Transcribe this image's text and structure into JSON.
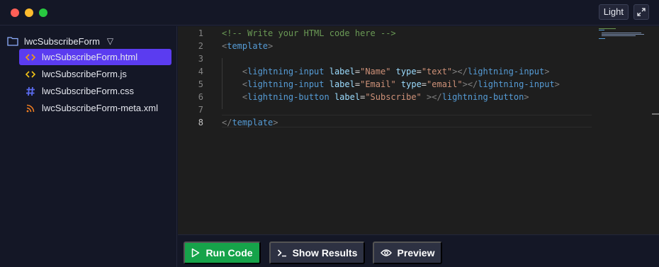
{
  "window": {
    "theme_toggle_label": "Light"
  },
  "sidebar": {
    "folder_name": "lwcSubscribeForm",
    "folder_caret": "▽",
    "files": [
      {
        "name": "lwcSubscribeForm.html",
        "icon": "html-code-icon",
        "icon_color": "#f59e0b",
        "active": true
      },
      {
        "name": "lwcSubscribeForm.js",
        "icon": "js-code-icon",
        "icon_color": "#f5c518",
        "active": false
      },
      {
        "name": "lwcSubscribeForm.css",
        "icon": "css-hash-icon",
        "icon_color": "#5b6cf0",
        "active": false
      },
      {
        "name": "lwcSubscribeForm-meta.xml",
        "icon": "rss-icon",
        "icon_color": "#ef7d22",
        "active": false
      }
    ]
  },
  "editor": {
    "current_line": 8,
    "lines": [
      {
        "n": "1",
        "tokens": [
          {
            "t": "<!-- Write your HTML code here -->",
            "c": "comment"
          }
        ]
      },
      {
        "n": "2",
        "tokens": [
          {
            "t": "<",
            "c": "punc"
          },
          {
            "t": "template",
            "c": "tag"
          },
          {
            "t": ">",
            "c": "punc"
          }
        ]
      },
      {
        "n": "3",
        "tokens": []
      },
      {
        "n": "4",
        "tokens": [
          {
            "t": "    <",
            "c": "punc"
          },
          {
            "t": "lightning-input",
            "c": "tag"
          },
          {
            "t": " label",
            "c": "attr"
          },
          {
            "t": "=",
            "c": "eq"
          },
          {
            "t": "\"Name\"",
            "c": "str"
          },
          {
            "t": " type",
            "c": "attr"
          },
          {
            "t": "=",
            "c": "eq"
          },
          {
            "t": "\"text\"",
            "c": "str"
          },
          {
            "t": "></",
            "c": "punc"
          },
          {
            "t": "lightning-input",
            "c": "tag"
          },
          {
            "t": ">",
            "c": "punc"
          }
        ]
      },
      {
        "n": "5",
        "tokens": [
          {
            "t": "    <",
            "c": "punc"
          },
          {
            "t": "lightning-input",
            "c": "tag"
          },
          {
            "t": " label",
            "c": "attr"
          },
          {
            "t": "=",
            "c": "eq"
          },
          {
            "t": "\"Email\"",
            "c": "str"
          },
          {
            "t": " type",
            "c": "attr"
          },
          {
            "t": "=",
            "c": "eq"
          },
          {
            "t": "\"email\"",
            "c": "str"
          },
          {
            "t": "></",
            "c": "punc"
          },
          {
            "t": "lightning-input",
            "c": "tag"
          },
          {
            "t": ">",
            "c": "punc"
          }
        ]
      },
      {
        "n": "6",
        "tokens": [
          {
            "t": "    <",
            "c": "punc"
          },
          {
            "t": "lightning-button",
            "c": "tag"
          },
          {
            "t": " label",
            "c": "attr"
          },
          {
            "t": "=",
            "c": "eq"
          },
          {
            "t": "\"Subscribe\"",
            "c": "str"
          },
          {
            "t": " ></",
            "c": "punc"
          },
          {
            "t": "lightning-button",
            "c": "tag"
          },
          {
            "t": ">",
            "c": "punc"
          }
        ]
      },
      {
        "n": "7",
        "tokens": []
      },
      {
        "n": "8",
        "tokens": [
          {
            "t": "</",
            "c": "punc"
          },
          {
            "t": "template",
            "c": "tag"
          },
          {
            "t": ">",
            "c": "punc"
          }
        ]
      }
    ]
  },
  "actions": {
    "run_label": "Run Code",
    "results_label": "Show Results",
    "preview_label": "Preview"
  },
  "colors": {
    "run_button": "#16a34a",
    "active_file": "#5b3cf0"
  }
}
